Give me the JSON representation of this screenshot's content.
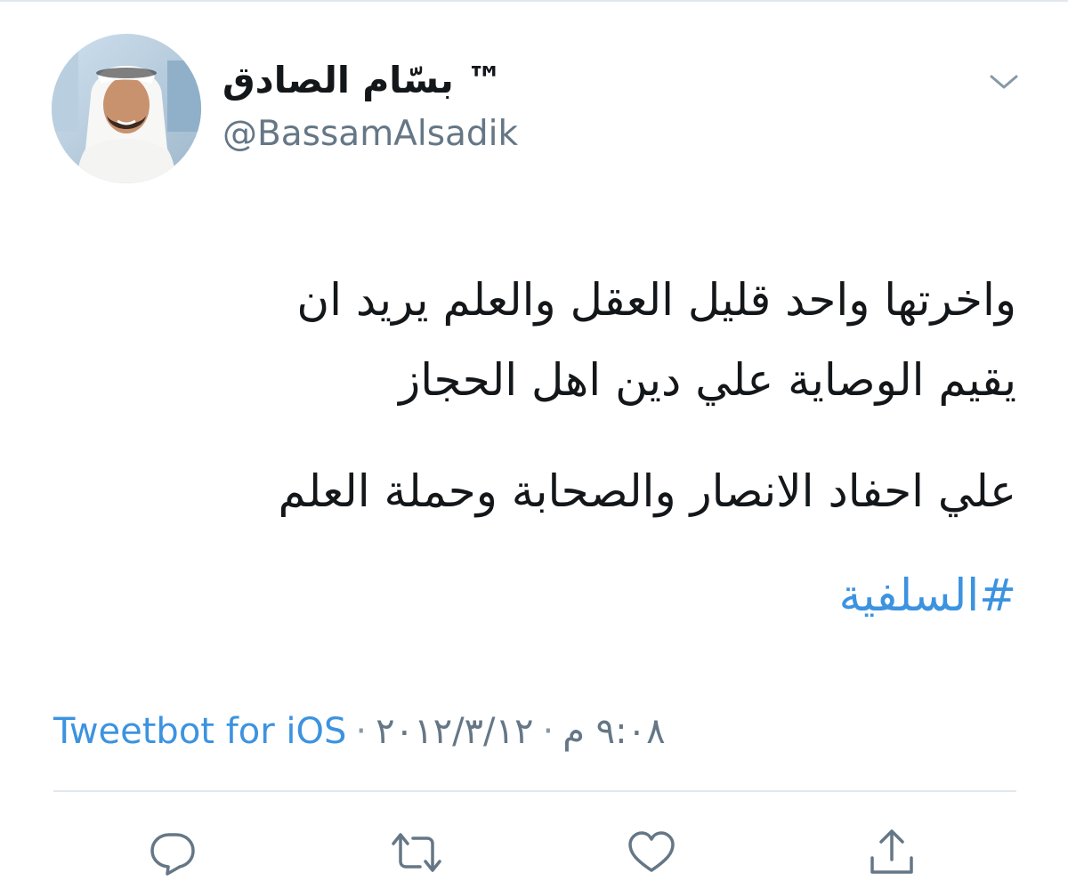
{
  "tweet": {
    "author": {
      "display_name": "بسّام الصادق ™",
      "handle": "@BassamAlsadik"
    },
    "text_lines": [
      "واخرتها واحد قليل العقل والعلم يريد ان",
      "يقيم الوصاية علي دين اهل الحجاز",
      "علي احفاد الانصار والصحابة وحملة العلم"
    ],
    "hashtag": "#السلفية",
    "meta": {
      "source": "Tweetbot for iOS",
      "separator": "·",
      "date": "٢٠١٢/٣/١٢",
      "time": "٩:٠٨ م"
    }
  },
  "icons": {
    "menu": "chevron-down-icon",
    "reply": "reply-icon",
    "retweet": "retweet-icon",
    "like": "heart-icon",
    "share": "share-icon"
  },
  "colors": {
    "link": "#3c93e0",
    "text": "#14171a",
    "secondary": "#657786",
    "divider": "#e1e8ed",
    "icon": "#657786"
  }
}
